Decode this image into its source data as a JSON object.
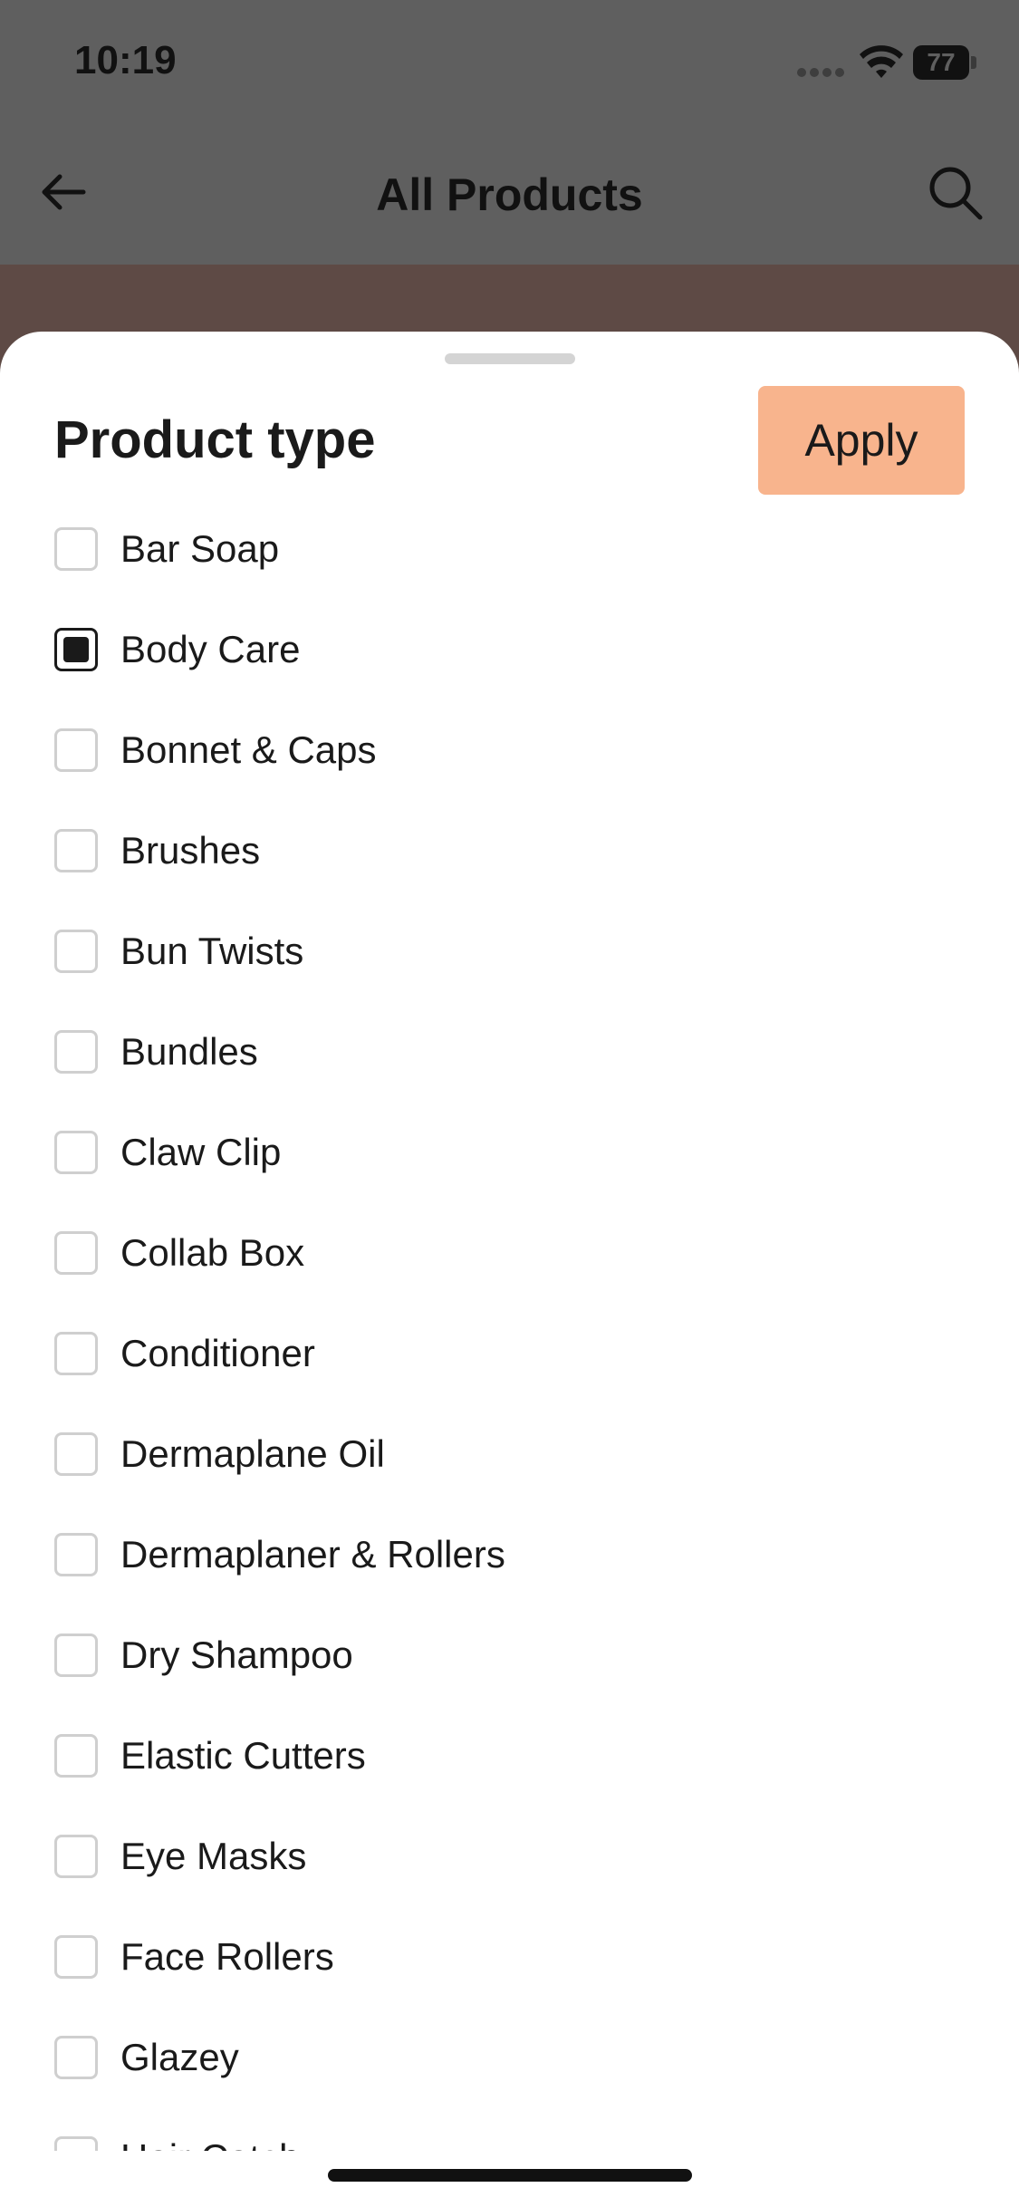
{
  "status": {
    "time": "10:19",
    "battery": "77"
  },
  "nav": {
    "title": "All Products"
  },
  "sheet": {
    "title": "Product type",
    "apply_label": "Apply",
    "accent_color": "#f8b48d",
    "options": [
      {
        "label": "Bar Soap",
        "checked": false
      },
      {
        "label": "Body Care",
        "checked": true
      },
      {
        "label": "Bonnet & Caps",
        "checked": false
      },
      {
        "label": "Brushes",
        "checked": false
      },
      {
        "label": "Bun Twists",
        "checked": false
      },
      {
        "label": "Bundles",
        "checked": false
      },
      {
        "label": "Claw Clip",
        "checked": false
      },
      {
        "label": "Collab Box",
        "checked": false
      },
      {
        "label": "Conditioner",
        "checked": false
      },
      {
        "label": "Dermaplane Oil",
        "checked": false
      },
      {
        "label": "Dermaplaner & Rollers",
        "checked": false
      },
      {
        "label": "Dry Shampoo",
        "checked": false
      },
      {
        "label": "Elastic Cutters",
        "checked": false
      },
      {
        "label": "Eye Masks",
        "checked": false
      },
      {
        "label": "Face Rollers",
        "checked": false
      },
      {
        "label": "Glazey",
        "checked": false
      },
      {
        "label": "Hair Catch",
        "checked": false
      }
    ]
  }
}
